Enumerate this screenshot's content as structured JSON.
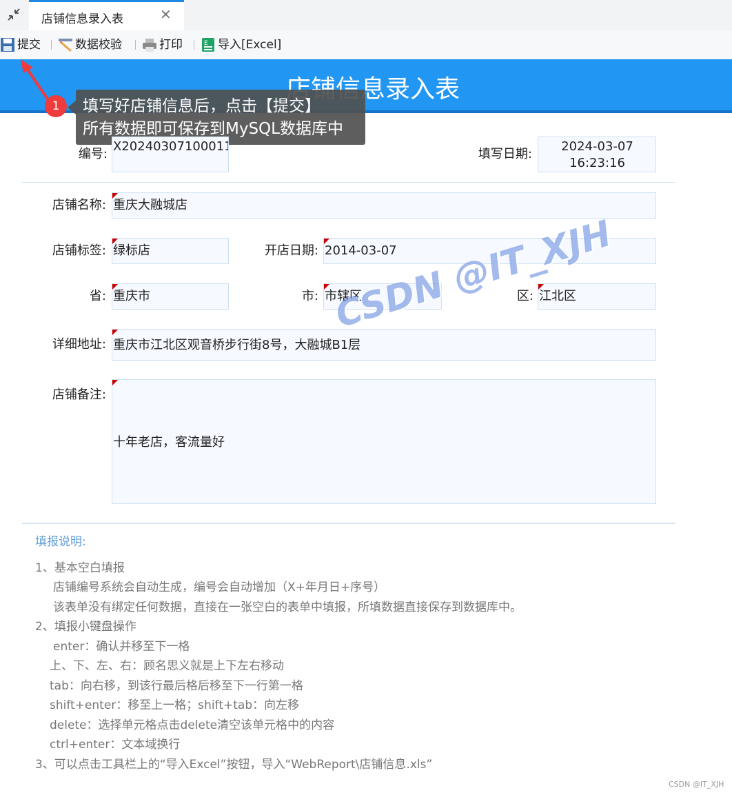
{
  "tab": {
    "label": "店铺信息录入表"
  },
  "toolbar": {
    "submit": "提交",
    "validate": "数据校验",
    "print": "打印",
    "import": "导入[Excel]"
  },
  "header": {
    "title": "店铺信息录入表"
  },
  "callout": {
    "badge": "1",
    "line1": "填写好店铺信息后，点击【提交】",
    "line2": "所有数据即可保存到MySQL数据库中"
  },
  "form": {
    "id_label": "编号:",
    "id_value": "X20240307100011",
    "date_label": "填写日期:",
    "date_value_line1": "2024-03-07",
    "date_value_line2": "16:23:16",
    "name_label": "店铺名称:",
    "name_value": "重庆大融城店",
    "tag_label": "店铺标签:",
    "tag_value": "绿标店",
    "open_label": "开店日期:",
    "open_value": "2014-03-07",
    "province_label": "省:",
    "province_value": "重庆市",
    "city_label": "市:",
    "city_value": "市辖区",
    "district_label": "区:",
    "district_value": "江北区",
    "address_label": "详细地址:",
    "address_value": "重庆市江北区观音桥步行街8号，大融城B1层",
    "remark_label": "店铺备注:",
    "remark_value": "十年老店，客流量好"
  },
  "notes": {
    "title": "填报说明:",
    "lines": [
      "1、基本空白填报",
      "店铺编号系统会自动生成，编号会自动增加（X+年月日+序号）",
      "该表单没有绑定任何数据，直接在一张空白的表单中填报，所填数据直接保存到数据库中。",
      "2、填报小键盘操作",
      "enter：确认并移至下一格",
      "上、下、左、右：顾名思义就是上下左右移动",
      "tab：向右移，到该行最后格后移至下一行第一格",
      "shift+enter：移至上一格；shift+tab：向左移",
      "delete：选择单元格点击delete清空该单元格中的内容",
      "ctrl+enter：文本域换行",
      "3、可以点击工具栏上的“导入Excel”按钮，导入“WebReport\\店铺信息.xls”"
    ]
  },
  "watermark": "CSDN @IT_XJH",
  "footer_mark": "CSDN @IT_XJH",
  "colors": {
    "accent": "#2196f3",
    "badge": "#ef3b3b",
    "required_marker": "#cc0000"
  }
}
